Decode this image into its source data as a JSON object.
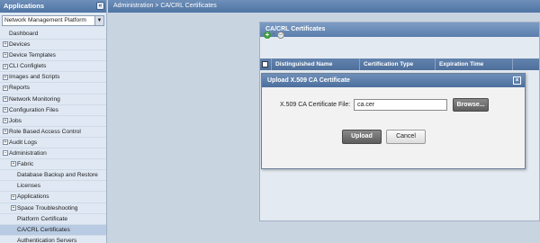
{
  "sidebar": {
    "title": "Applications",
    "platform_select": "Network Management Platform",
    "items": [
      {
        "label": "Dashboard",
        "level": 0,
        "expandable": false
      },
      {
        "label": "Devices",
        "level": 0,
        "expandable": true
      },
      {
        "label": "Device Templates",
        "level": 0,
        "expandable": true
      },
      {
        "label": "CLI Configlets",
        "level": 0,
        "expandable": true
      },
      {
        "label": "Images and Scripts",
        "level": 0,
        "expandable": true
      },
      {
        "label": "Reports",
        "level": 0,
        "expandable": true
      },
      {
        "label": "Network Monitoring",
        "level": 0,
        "expandable": true
      },
      {
        "label": "Configuration Files",
        "level": 0,
        "expandable": true
      },
      {
        "label": "Jobs",
        "level": 0,
        "expandable": true
      },
      {
        "label": "Role Based Access Control",
        "level": 0,
        "expandable": true
      },
      {
        "label": "Audit Logs",
        "level": 0,
        "expandable": true
      },
      {
        "label": "Administration",
        "level": 0,
        "expandable": true,
        "expanded": true
      },
      {
        "label": "Fabric",
        "level": 1,
        "expandable": true
      },
      {
        "label": "Database Backup and Restore",
        "level": 1,
        "expandable": false
      },
      {
        "label": "Licenses",
        "level": 1,
        "expandable": false
      },
      {
        "label": "Applications",
        "level": 1,
        "expandable": true
      },
      {
        "label": "Space Troubleshooting",
        "level": 1,
        "expandable": true
      },
      {
        "label": "Platform Certificate",
        "level": 1,
        "expandable": false
      },
      {
        "label": "CA/CRL Certificates",
        "level": 1,
        "expandable": false,
        "active": true
      },
      {
        "label": "Authentication Servers",
        "level": 1,
        "expandable": false
      }
    ]
  },
  "breadcrumb": "Administration > CA/CRL Certificates",
  "panel": {
    "title": "CA/CRL Certificates",
    "columns": [
      "Distinguished Name",
      "Certification Type",
      "Expiration Time"
    ]
  },
  "modal": {
    "title": "Upload X.509 CA Certificate",
    "file_label": "X.509 CA Certificate File:",
    "file_value": "ca.cer",
    "browse_label": "Browse...",
    "upload_label": "Upload",
    "cancel_label": "Cancel"
  },
  "icons": {
    "collapse": "collapse-icon",
    "add": "add-icon",
    "remove": "remove-icon",
    "close": "close-icon",
    "expander": "expand-icon"
  },
  "colors": {
    "header_blue": "#4f74a3",
    "sidebar_bg": "#dfe8f3",
    "active_item": "#b8cbe3",
    "add_green": "#3f9a3c"
  }
}
